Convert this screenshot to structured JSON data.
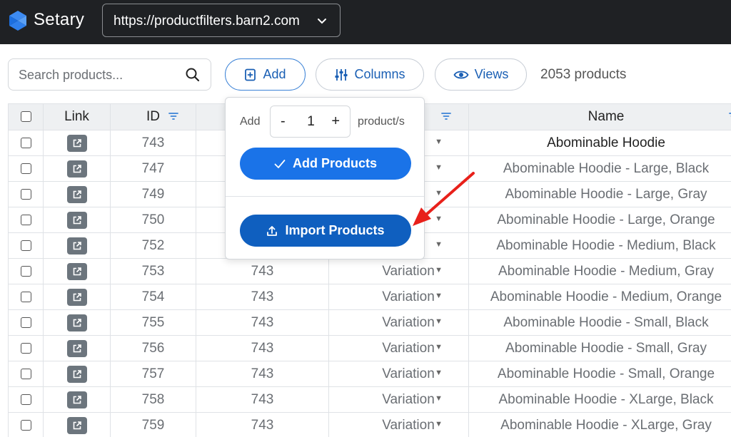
{
  "app": {
    "name": "Setary",
    "site_url": "https://productfilters.barn2.com",
    "brand_color": "#2f80ed"
  },
  "toolbar": {
    "search_placeholder": "Search products...",
    "add_label": "Add",
    "columns_label": "Columns",
    "views_label": "Views",
    "product_count": "2053 products"
  },
  "popover": {
    "add_label": "Add",
    "quantity": "1",
    "minus": "-",
    "plus": "+",
    "unit_label": "product/s",
    "add_products_label": "Add Products",
    "import_products_label": "Import Products"
  },
  "table": {
    "headers": {
      "link": "Link",
      "id": "ID",
      "name": "Name"
    },
    "rows": [
      {
        "id": "743",
        "parent": "",
        "type": "",
        "name": "Abominable Hoodie"
      },
      {
        "id": "747",
        "parent": "",
        "type": "",
        "name": "Abominable Hoodie - Large, Black"
      },
      {
        "id": "749",
        "parent": "",
        "type": "",
        "name": "Abominable Hoodie - Large, Gray"
      },
      {
        "id": "750",
        "parent": "",
        "type": "",
        "name": "Abominable Hoodie - Large, Orange"
      },
      {
        "id": "752",
        "parent": "",
        "type": "",
        "name": "Abominable Hoodie - Medium, Black"
      },
      {
        "id": "753",
        "parent": "743",
        "type": "Variation",
        "name": "Abominable Hoodie - Medium, Gray"
      },
      {
        "id": "754",
        "parent": "743",
        "type": "Variation",
        "name": "Abominable Hoodie - Medium, Orange"
      },
      {
        "id": "755",
        "parent": "743",
        "type": "Variation",
        "name": "Abominable Hoodie - Small, Black"
      },
      {
        "id": "756",
        "parent": "743",
        "type": "Variation",
        "name": "Abominable Hoodie - Small, Gray"
      },
      {
        "id": "757",
        "parent": "743",
        "type": "Variation",
        "name": "Abominable Hoodie - Small, Orange"
      },
      {
        "id": "758",
        "parent": "743",
        "type": "Variation",
        "name": "Abominable Hoodie - XLarge, Black"
      },
      {
        "id": "759",
        "parent": "743",
        "type": "Variation",
        "name": "Abominable Hoodie - XLarge, Gray"
      }
    ]
  },
  "annotation": {
    "arrow_color": "#e8201a"
  },
  "colors": {
    "topbar": "#1f2124",
    "primary": "#1a73e8",
    "primary_dark": "#0f5fbf",
    "link_button": "#6c757d"
  }
}
